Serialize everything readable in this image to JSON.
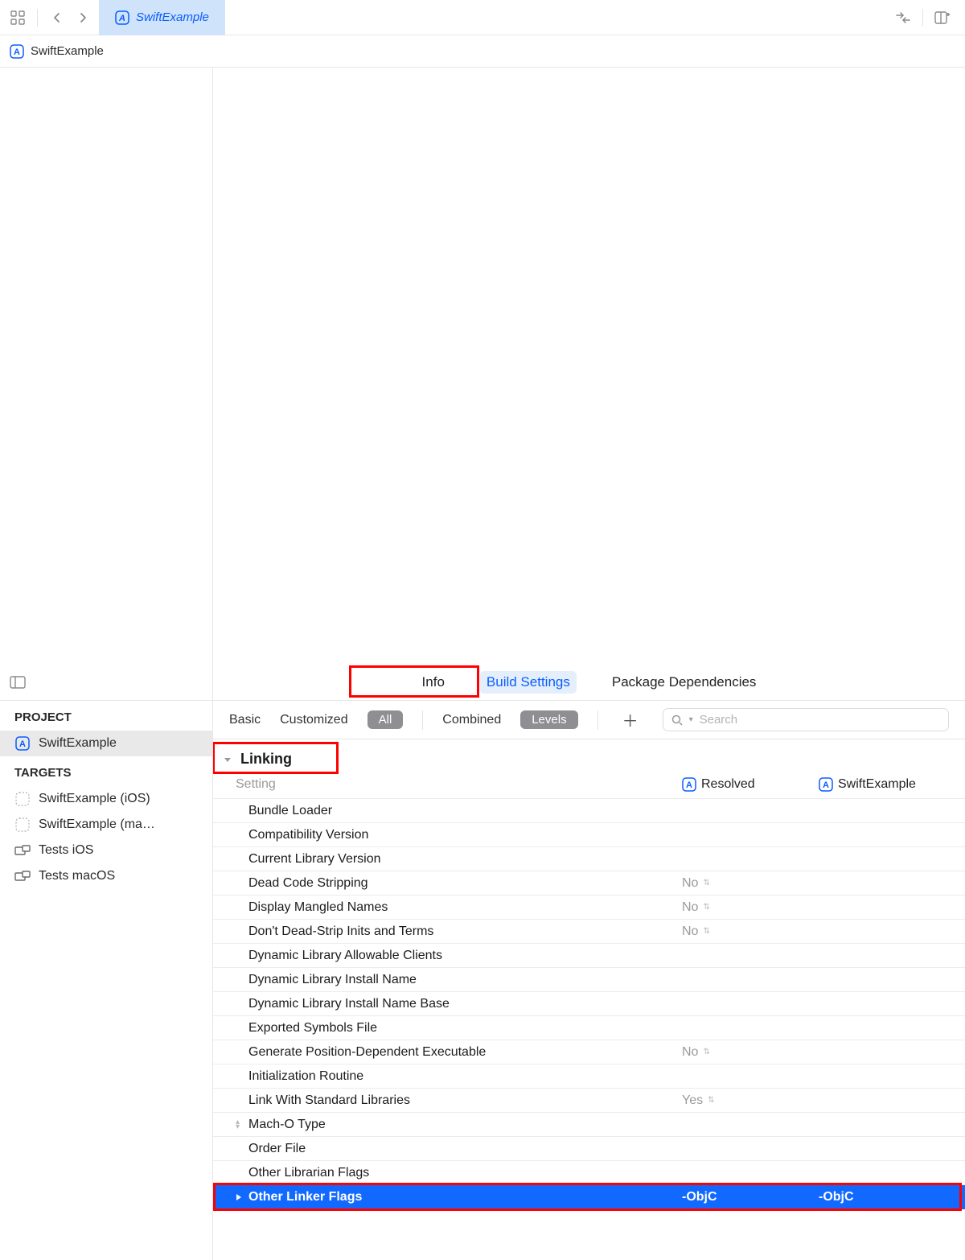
{
  "toolbar": {
    "active_tab": "SwiftExample"
  },
  "breadcrumb": {
    "project": "SwiftExample"
  },
  "nav_tabs": {
    "info": "Info",
    "build_settings": "Build Settings",
    "package_deps": "Package Dependencies"
  },
  "sidebar": {
    "project_heading": "PROJECT",
    "project_name": "SwiftExample",
    "targets_heading": "TARGETS",
    "targets": [
      {
        "label": "SwiftExample (iOS)"
      },
      {
        "label": "SwiftExample (ma…"
      },
      {
        "label": "Tests iOS"
      },
      {
        "label": "Tests macOS"
      }
    ]
  },
  "filters": {
    "basic": "Basic",
    "customized": "Customized",
    "all": "All",
    "combined": "Combined",
    "levels": "Levels",
    "search_placeholder": "Search"
  },
  "columns": {
    "setting": "Setting",
    "resolved": "Resolved",
    "project": "SwiftExample"
  },
  "group": {
    "name": "Linking"
  },
  "settings": [
    {
      "label": "Bundle Loader",
      "resolved": "",
      "project": ""
    },
    {
      "label": "Compatibility Version",
      "resolved": "",
      "project": ""
    },
    {
      "label": "Current Library Version",
      "resolved": "",
      "project": ""
    },
    {
      "label": "Dead Code Stripping",
      "resolved": "No",
      "project": "",
      "dd": true
    },
    {
      "label": "Display Mangled Names",
      "resolved": "No",
      "project": "",
      "dd": true
    },
    {
      "label": "Don't Dead-Strip Inits and Terms",
      "resolved": "No",
      "project": "",
      "dd": true
    },
    {
      "label": "Dynamic Library Allowable Clients",
      "resolved": "",
      "project": ""
    },
    {
      "label": "Dynamic Library Install Name",
      "resolved": "",
      "project": ""
    },
    {
      "label": "Dynamic Library Install Name Base",
      "resolved": "",
      "project": ""
    },
    {
      "label": "Exported Symbols File",
      "resolved": "",
      "project": ""
    },
    {
      "label": "Generate Position-Dependent Executable",
      "resolved": "No",
      "project": "",
      "dd": true
    },
    {
      "label": "Initialization Routine",
      "resolved": "",
      "project": ""
    },
    {
      "label": "Link With Standard Libraries",
      "resolved": "Yes",
      "project": "",
      "dd": true
    },
    {
      "label": "Mach-O Type",
      "resolved": "",
      "project": "",
      "expand": true
    },
    {
      "label": "Order File",
      "resolved": "",
      "project": ""
    },
    {
      "label": "Other Librarian Flags",
      "resolved": "",
      "project": ""
    },
    {
      "label": "Other Linker Flags",
      "resolved": "-ObjC",
      "project": "-ObjC",
      "selected": true,
      "expand": true
    }
  ]
}
